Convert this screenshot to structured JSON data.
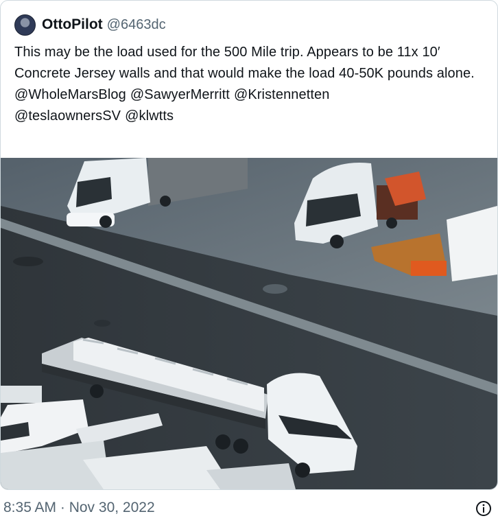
{
  "tweet": {
    "display_name": "OttoPilot",
    "handle": "@6463dc",
    "text": "This may be the load used for the 500 Mile trip. Appears to be 11x 10′ Concrete Jersey walls and that would make the load 40-50K pounds alone.",
    "mentions": [
      "@WholeMarsBlog",
      "@SawyerMerritt",
      "@Kristennetten",
      "@teslaownersSV",
      "@klwtts"
    ],
    "timestamp": "8:35 AM · Nov 30, 2022"
  },
  "icons": {
    "avatar": "avatar-image",
    "info": "info-icon"
  },
  "colors": {
    "text": "#0f1419",
    "muted": "#536471",
    "border": "#cfd9de"
  }
}
